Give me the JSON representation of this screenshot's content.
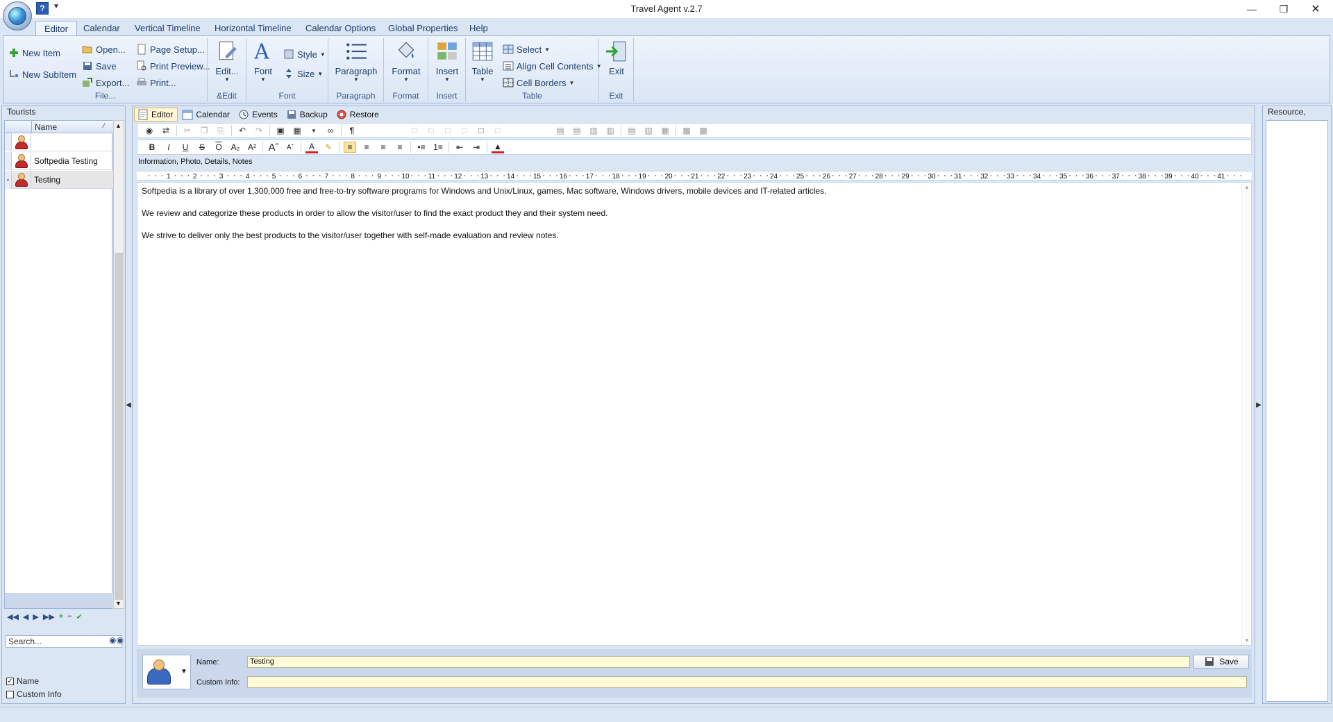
{
  "window": {
    "title": "Travel Agent v.2.7",
    "controls": [
      "minimize",
      "restore",
      "close"
    ]
  },
  "ribbon_tabs": [
    "Editor",
    "Calendar",
    "Vertical Timeline",
    "Horizontal Timeline",
    "Calendar Options",
    "Global Properties",
    "Help"
  ],
  "ribbon": {
    "file_group": {
      "label": "File...",
      "new_item": "New Item",
      "new_subitem": "New SubItem",
      "open": "Open...",
      "save": "Save",
      "export": "Export...",
      "page_setup": "Page Setup...",
      "print_preview": "Print Preview...",
      "print": "Print..."
    },
    "edit_group": {
      "label": "&Edit",
      "edit": "Edit..."
    },
    "font_group": {
      "label": "Font",
      "font": "Font",
      "style": "Style",
      "size": "Size"
    },
    "paragraph_group": {
      "label": "Paragraph",
      "paragraph": "Paragraph"
    },
    "format_group": {
      "label": "Format",
      "format": "Format"
    },
    "insert_group": {
      "label": "Insert",
      "insert": "Insert"
    },
    "table_group": {
      "label": "Table",
      "table": "Table",
      "select": "Select",
      "align": "Align Cell Contents",
      "borders": "Cell Borders"
    },
    "exit_group": {
      "label": "Exit",
      "exit": "Exit"
    }
  },
  "tourists": {
    "title": "Tourists",
    "column": "Name",
    "rows": [
      "",
      "Softpedia Testing",
      "Testing"
    ],
    "search_placeholder": "Search...",
    "filters": [
      {
        "label": "Name",
        "checked": true
      },
      {
        "label": "Custom Info",
        "checked": false
      }
    ]
  },
  "doc_tabs": [
    "Editor",
    "Calendar",
    "Events",
    "Backup",
    "Restore"
  ],
  "info_line": "Information, Photo, Details, Notes",
  "ruler_numbers": [
    "1",
    "2",
    "3",
    "4",
    "5",
    "6",
    "7",
    "8",
    "9",
    "10",
    "11",
    "12",
    "13",
    "14",
    "15",
    "16",
    "17",
    "18",
    "19",
    "20",
    "21",
    "22",
    "23",
    "24",
    "25",
    "26",
    "27",
    "28",
    "29",
    "30",
    "31",
    "32",
    "33",
    "34",
    "35",
    "36",
    "37",
    "38",
    "39",
    "40",
    "41"
  ],
  "document": {
    "paragraphs": [
      "Softpedia is a library of over 1,300,000 free and free-to-try software programs for Windows and Unix/Linux, games, Mac software, Windows drivers, mobile devices and IT-related articles.",
      "We review and categorize these products in order to allow the visitor/user to find the exact product they and their system need.",
      "We strive to deliver only the best products to the visitor/user together with self-made evaluation and review notes."
    ]
  },
  "details": {
    "name_label": "Name:",
    "name_value": "Testing",
    "custom_label": "Custom Info:",
    "custom_value": "",
    "save_label": "Save"
  },
  "right_panel": {
    "title": "Resource, Agent:"
  }
}
